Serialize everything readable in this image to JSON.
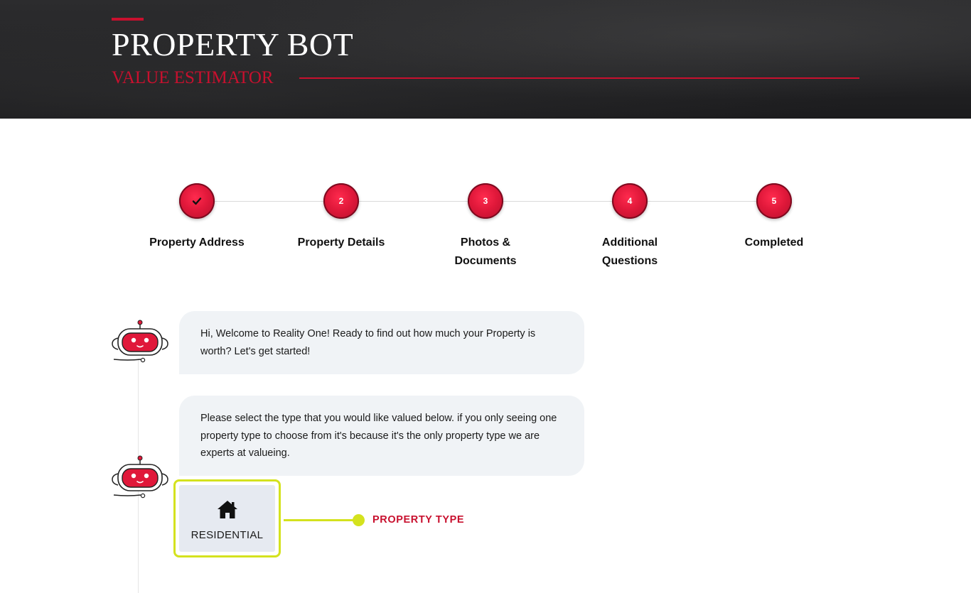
{
  "header": {
    "title": "PROPERTY BOT",
    "subtitle": "VALUE ESTIMATOR"
  },
  "steps": [
    {
      "number": "",
      "icon": "check-icon",
      "label": "Property Address",
      "status": "completed"
    },
    {
      "number": "2",
      "label": "Property Details",
      "status": "pending"
    },
    {
      "number": "3",
      "label": "Photos &\nDocuments",
      "label_line1": "Photos &",
      "label_line2": "Documents",
      "status": "pending"
    },
    {
      "number": "4",
      "label_line1": "Additional",
      "label_line2": "Questions",
      "status": "pending"
    },
    {
      "number": "5",
      "label": "Completed",
      "status": "pending"
    }
  ],
  "chat": {
    "messages": [
      {
        "text": "Hi, Welcome to Reality One! Ready to find out how much your Property is worth? Let's get started!"
      },
      {
        "text": "Please select the type that you would like valued below. if you only seeing one property type to choose from it's because it's the only property type we are experts at valueing."
      }
    ],
    "options": [
      {
        "icon": "home-icon",
        "label": "RESIDENTIAL",
        "selected": true
      }
    ],
    "callout": "PROPERTY TYPE"
  },
  "colors": {
    "accent_red": "#c8102e",
    "highlight_lime": "#d4e21e",
    "bubble_bg": "#f0f3f6",
    "step_circle": "#e0183a"
  }
}
